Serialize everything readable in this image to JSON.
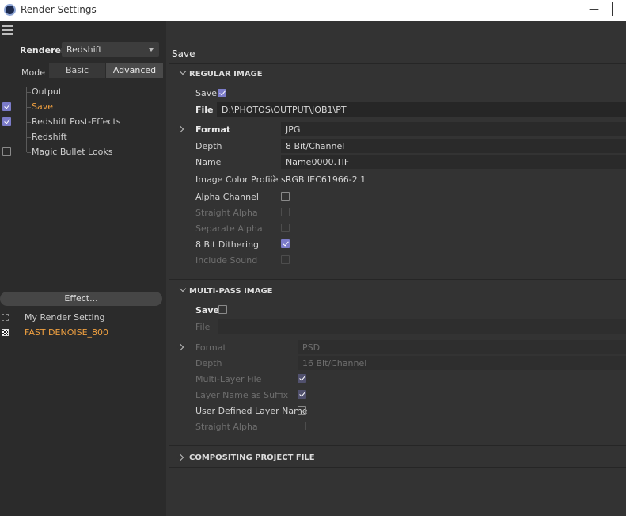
{
  "window": {
    "title": "Render Settings",
    "minimize": "—"
  },
  "left": {
    "renderer_label": "Renderer",
    "renderer_value": "Redshift",
    "mode_label": "Mode",
    "modes": [
      "Basic",
      "Advanced"
    ],
    "active_mode": "Advanced",
    "tree": [
      {
        "label": "Output",
        "checked": null,
        "active": false
      },
      {
        "label": "Save",
        "checked": true,
        "active": true
      },
      {
        "label": "Redshift Post-Effects",
        "checked": true,
        "active": false
      },
      {
        "label": "Redshift",
        "checked": null,
        "active": false
      },
      {
        "label": "Magic Bullet Looks",
        "checked": false,
        "active": false
      }
    ],
    "effect_button": "Effect...",
    "settings": [
      {
        "label": "My Render Setting",
        "icon": "dashed-square-icon",
        "active": false
      },
      {
        "label": "FAST DENOISE_800",
        "icon": "checker-square-icon",
        "active": true
      }
    ]
  },
  "right": {
    "header": "Save",
    "regular": {
      "title": "REGULAR IMAGE",
      "save_label": "Save",
      "file_label": "File",
      "file_value": "D:\\PHOTOS\\OUTPUT\\JOB1\\PT",
      "format_label": "Format",
      "format_value": "JPG",
      "depth_label": "Depth",
      "depth_value": "8 Bit/Channel",
      "name_label": "Name",
      "name_value": "Name0000.TIF",
      "profile_label": "Image Color Profile",
      "profile_value": "sRGB IEC61966-2.1",
      "alpha_label": "Alpha Channel",
      "straight_label": "Straight Alpha",
      "separate_label": "Separate Alpha",
      "dither_label": "8 Bit Dithering",
      "sound_label": "Include Sound"
    },
    "multipass": {
      "title": "MULTI-PASS IMAGE",
      "save_label": "Save",
      "file_label": "File",
      "format_label": "Format",
      "format_value": "PSD",
      "depth_label": "Depth",
      "depth_value": "16 Bit/Channel",
      "multilayer_label": "Multi-Layer File",
      "suffix_label": "Layer Name as Suffix",
      "userdef_label": "User Defined Layer Name",
      "straight_label": "Straight Alpha"
    },
    "compositing": {
      "title": "COMPOSITING PROJECT FILE"
    }
  }
}
